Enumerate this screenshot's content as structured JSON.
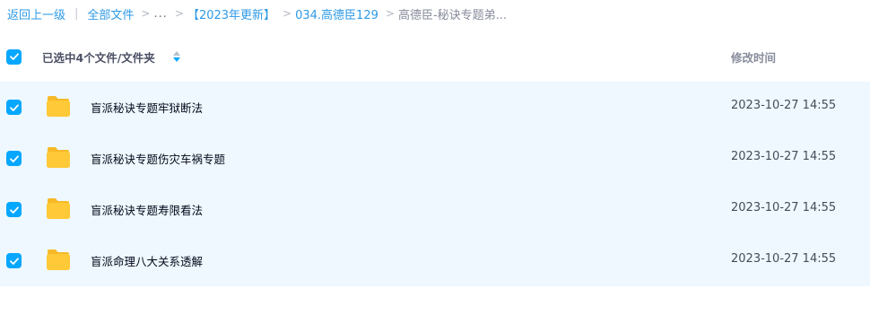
{
  "breadcrumb": {
    "back": "返回上一级",
    "all_files": "全部文件",
    "ellipsis": "...",
    "crumb_1": "【2023年更新】",
    "crumb_2": "034.高德臣129",
    "current": "高德臣-秘诀专题弟..."
  },
  "list_header": {
    "selection_text": "已选中4个文件/文件夹",
    "time_column": "修改时间"
  },
  "files": [
    {
      "name": "盲派秘诀专题牢狱断法",
      "modified": "2023-10-27 14:55",
      "checked": true
    },
    {
      "name": "盲派秘诀专题伤灾车祸专题",
      "modified": "2023-10-27 14:55",
      "checked": true
    },
    {
      "name": "盲派秘诀专题寿限看法",
      "modified": "2023-10-27 14:55",
      "checked": true
    },
    {
      "name": "盲派命理八大关系透解",
      "modified": "2023-10-27 14:55",
      "checked": true
    }
  ],
  "colors": {
    "accent": "#06a7ff",
    "link": "#2e9ae6",
    "row_selected_bg": "#eef8fe",
    "folder": "#ffc937"
  },
  "icons": {
    "checkbox": "check-icon",
    "folder": "folder-icon",
    "sort": "sort-icon"
  }
}
